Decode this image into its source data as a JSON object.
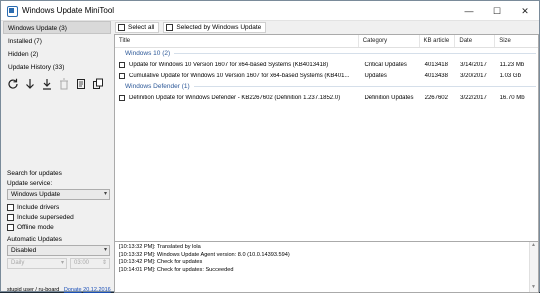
{
  "window": {
    "title": "Windows Update MiniTool",
    "min": "—",
    "max": "☐",
    "close": "✕"
  },
  "nav": [
    {
      "label": "Windows Update (3)"
    },
    {
      "label": "Installed (7)"
    },
    {
      "label": "Hidden (2)"
    },
    {
      "label": "Update History (33)"
    }
  ],
  "toolbar": [
    "refresh-icon",
    "download-icon",
    "install-icon",
    "delete-icon",
    "hide-icon",
    "copy-icon"
  ],
  "search": {
    "heading": "Search for updates",
    "service_label": "Update service:",
    "service_value": "Windows Update",
    "include_drivers": "Include drivers",
    "include_superseded": "Include superseded",
    "offline_mode": "Offline mode"
  },
  "auto": {
    "heading": "Automatic Updates",
    "mode_value": "Disabled",
    "day_value": "Daily",
    "time_value": "03:00"
  },
  "footer": {
    "credit": "stupid user / ru-board",
    "donate": "Donate",
    "date": "20.12.2016"
  },
  "select_all": "Select all",
  "selected_by_wu": "Selected by Windows Update",
  "columns": {
    "title": "Title",
    "category": "Category",
    "kb": "KB article",
    "date": "Date",
    "size": "Size"
  },
  "groups": [
    {
      "name": "Windows 10 (2)",
      "rows": [
        {
          "title": "Update for Windows 10 Version 1607 for x64-based Systems (KB4013418)",
          "category": "Critical Updates",
          "kb": "4013418",
          "date": "3/14/2017",
          "size": "11.23 Mb"
        },
        {
          "title": "Cumulative Update for Windows 10 Version 1607 for x64-based Systems (KB401...",
          "category": "Updates",
          "kb": "4013438",
          "date": "3/20/2017",
          "size": "1.03 Gb"
        }
      ]
    },
    {
      "name": "Windows Defender (1)",
      "rows": [
        {
          "title": "Definition Update for Windows Defender - KB2267602 (Definition 1.237.1852.0)",
          "category": "Definition Updates",
          "kb": "2267602",
          "date": "3/22/2017",
          "size": "16.70 Mb"
        }
      ]
    }
  ],
  "log": [
    "[10:13:32 PM]: Translated by lola",
    "[10:13:32 PM]: Windows Update Agent version: 8.0 (10.0.14393.594)",
    "[10:13:42 PM]: Check for updates",
    "[10:14:01 PM]: Check for updates: Succeeded"
  ]
}
